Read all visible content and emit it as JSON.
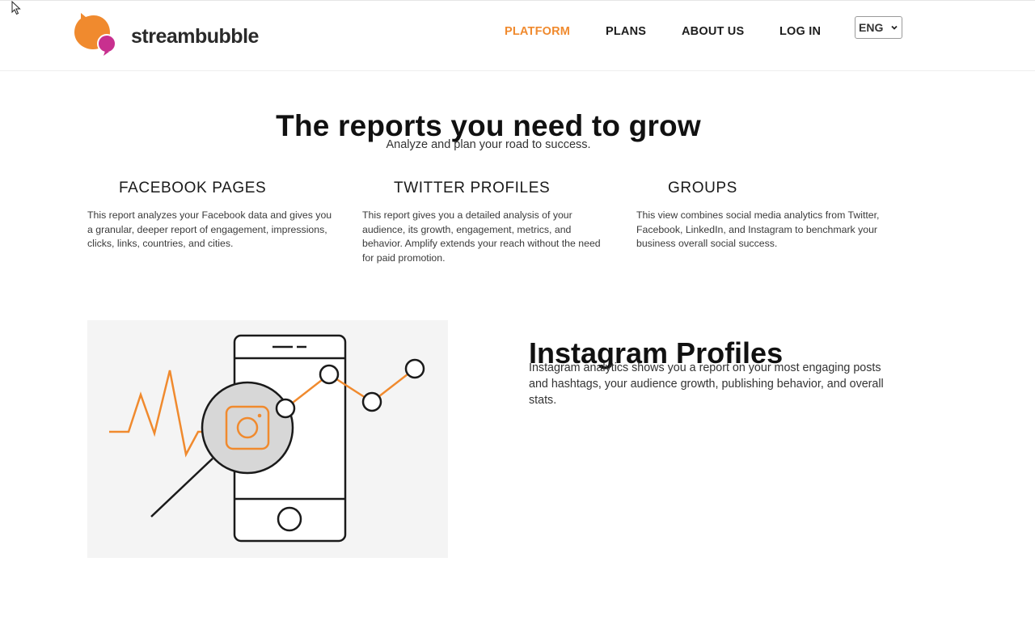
{
  "brand": {
    "name": "streambubble",
    "colors": {
      "orange": "#f08a2e",
      "magenta": "#c8308f"
    }
  },
  "nav": {
    "items": [
      {
        "label": "PLATFORM",
        "active": true
      },
      {
        "label": "PLANS",
        "active": false
      },
      {
        "label": "ABOUT US",
        "active": false
      },
      {
        "label": "LOG IN",
        "active": false
      }
    ],
    "language": {
      "selected": "ENG"
    }
  },
  "hero": {
    "title": "The reports you need to grow",
    "subtitle": "Analyze and plan your road to success."
  },
  "features": [
    {
      "title": "FACEBOOK PAGES",
      "description": "This report analyzes your Facebook data and gives you a granular, deeper report of engagement, impressions, clicks, links, countries, and cities."
    },
    {
      "title": "TWITTER PROFILES",
      "description": "This report gives you a detailed analysis of your audience, its growth, engagement, metrics, and behavior. Amplify extends your reach without the need for paid promotion."
    },
    {
      "title": "GROUPS",
      "description": "This view combines social media analytics from Twitter, Facebook, LinkedIn, and Instagram to benchmark your business overall social success."
    }
  ],
  "instagram": {
    "title": "Instagram Profiles",
    "description": "Instagram analytics shows you a report on your most engaging posts and hashtags, your audience growth, publishing behavior, and overall stats."
  }
}
